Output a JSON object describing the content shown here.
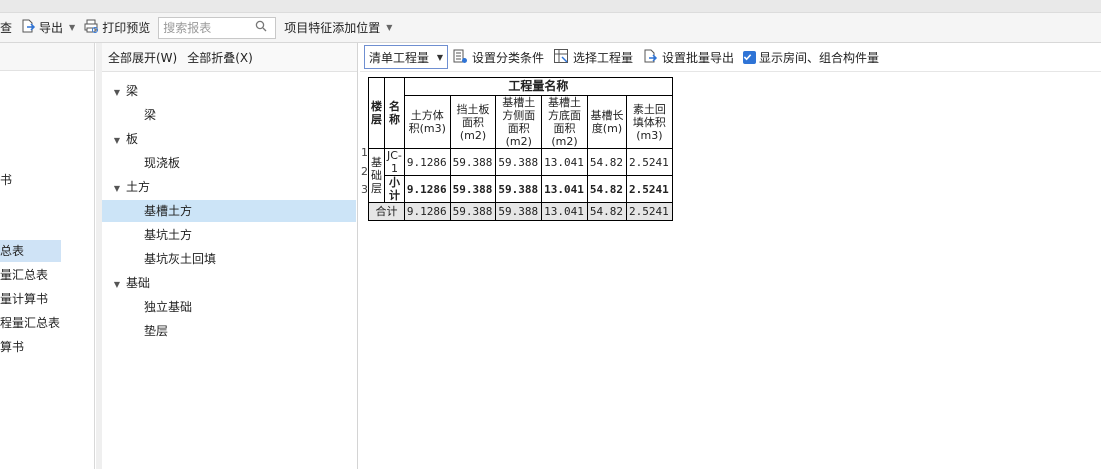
{
  "toolbar": {
    "check_label": "查",
    "export_label": "导出",
    "print_preview_label": "打印预览",
    "search_placeholder": "搜索报表",
    "feature_position_label": "项目特征添加位置"
  },
  "left_panel": {
    "items": [
      {
        "label": "书",
        "selected": false
      },
      {
        "label": "总表",
        "selected": true
      },
      {
        "label": "量汇总表",
        "selected": false
      },
      {
        "label": "量计算书",
        "selected": false
      },
      {
        "label": "程量汇总表",
        "selected": false
      },
      {
        "label": "算书",
        "selected": false
      }
    ]
  },
  "tree_panel": {
    "expand_all": "全部展开(W)",
    "collapse_all": "全部折叠(X)",
    "nodes": [
      {
        "label": "梁",
        "level": 1,
        "expanded": true
      },
      {
        "label": "梁",
        "level": 2
      },
      {
        "label": "板",
        "level": 1,
        "expanded": true
      },
      {
        "label": "现浇板",
        "level": 2
      },
      {
        "label": "土方",
        "level": 1,
        "expanded": true
      },
      {
        "label": "基槽土方",
        "level": 2,
        "selected": true
      },
      {
        "label": "基坑土方",
        "level": 2
      },
      {
        "label": "基坑灰土回填",
        "level": 2
      },
      {
        "label": "基础",
        "level": 1,
        "expanded": true
      },
      {
        "label": "独立基础",
        "level": 2
      },
      {
        "label": "垫层",
        "level": 2
      }
    ]
  },
  "main_toolbar": {
    "qty_type_selected": "清单工程量",
    "set_classification": "设置分类条件",
    "select_quantity": "选择工程量",
    "batch_export": "设置批量导出",
    "show_room_label": "显示房间、组合构件量",
    "show_room_checked": true
  },
  "report_table": {
    "floor_header": "楼层",
    "name_header": "名称",
    "group_header": "工程量名称",
    "columns": [
      "土方体积(m3)",
      "挡土板面积(m2)",
      "基槽土方侧面面积(m2)",
      "基槽土方底面面积(m2)",
      "基槽长度(m)",
      "素土回填体积(m3)"
    ],
    "row_numbers": [
      "1",
      "2",
      "3"
    ],
    "floor_value": "基础层",
    "rows": [
      {
        "name": "JC-1",
        "values": [
          "9.1286",
          "59.388",
          "59.388",
          "13.041",
          "54.82",
          "2.5241"
        ]
      },
      {
        "name": "小计",
        "values": [
          "9.1286",
          "59.388",
          "59.388",
          "13.041",
          "54.82",
          "2.5241"
        ]
      }
    ],
    "total": {
      "label": "合计",
      "values": [
        "9.1286",
        "59.388",
        "59.388",
        "13.041",
        "54.82",
        "2.5241"
      ]
    }
  }
}
